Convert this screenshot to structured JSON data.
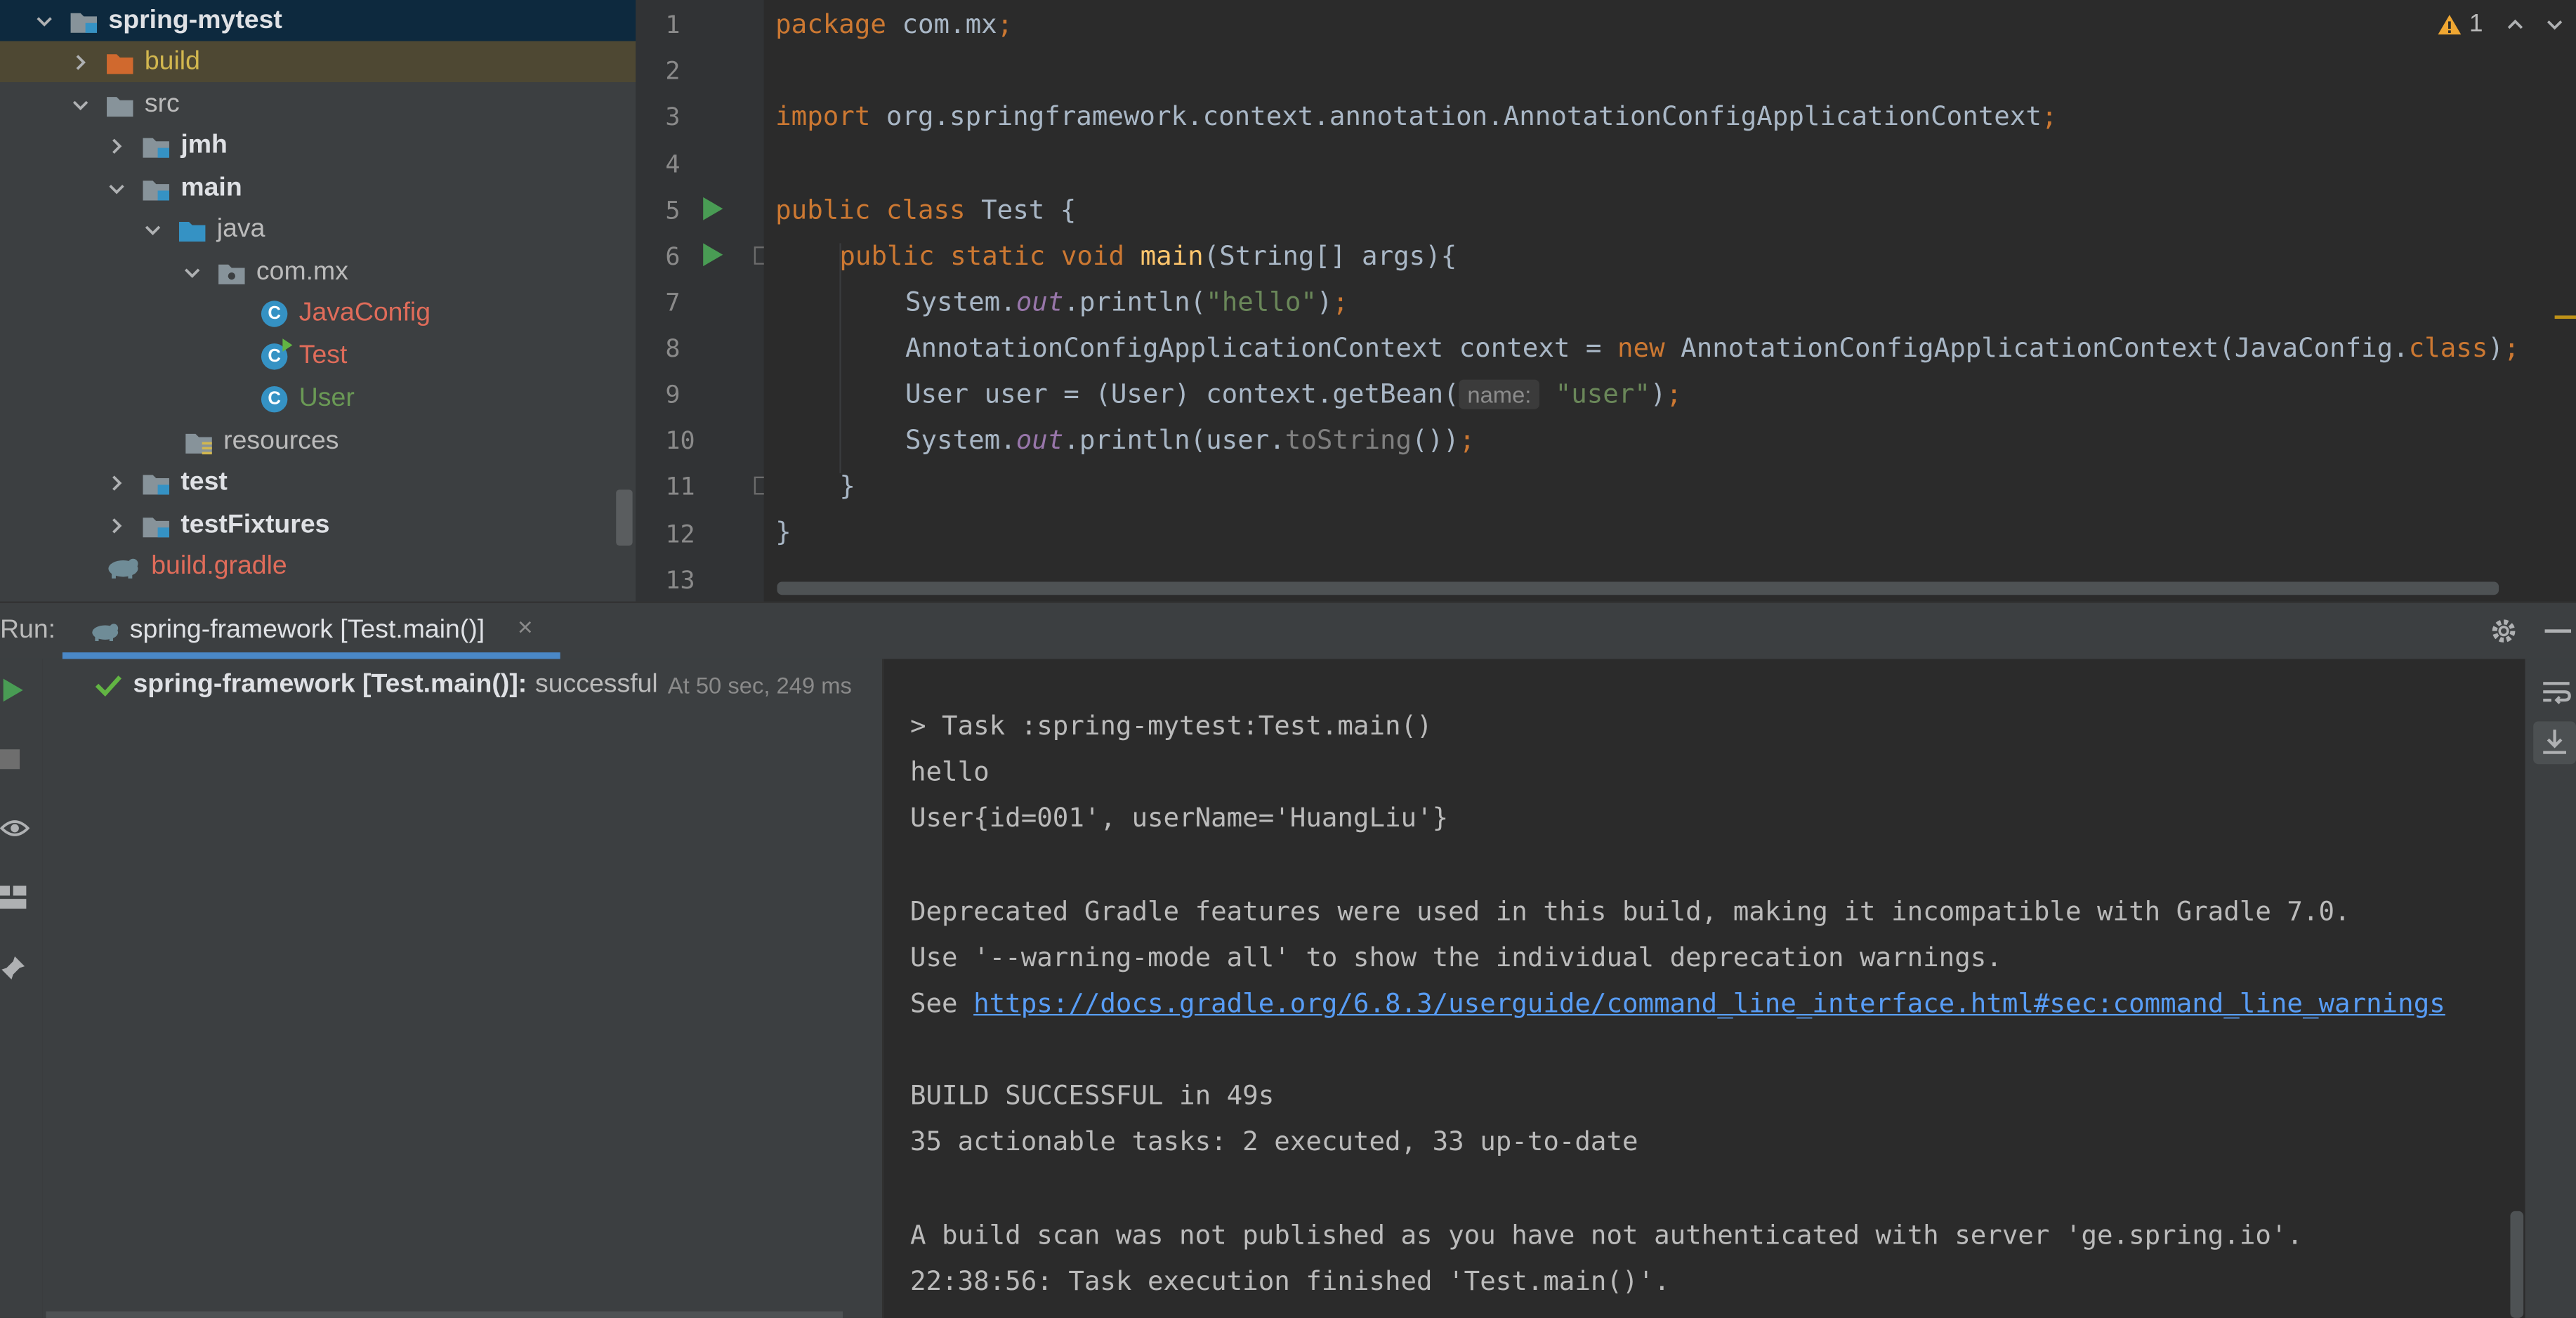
{
  "project_tree": {
    "items": [
      {
        "label": "spring-mytest",
        "level": 0,
        "expanded": true,
        "type": "module",
        "style": "bold"
      },
      {
        "label": "build",
        "level": 1,
        "expanded": false,
        "type": "folder-excluded",
        "style": "yellow"
      },
      {
        "label": "src",
        "level": 1,
        "expanded": true,
        "type": "folder"
      },
      {
        "label": "jmh",
        "level": 2,
        "expanded": false,
        "type": "folder",
        "style": "bold"
      },
      {
        "label": "main",
        "level": 2,
        "expanded": true,
        "type": "folder",
        "style": "bold"
      },
      {
        "label": "java",
        "level": 3,
        "expanded": true,
        "type": "source-folder"
      },
      {
        "label": "com.mx",
        "level": 4,
        "expanded": true,
        "type": "package"
      },
      {
        "label": "JavaConfig",
        "level": 5,
        "type": "class",
        "style": "red"
      },
      {
        "label": "Test",
        "level": 5,
        "type": "class-runnable",
        "style": "red"
      },
      {
        "label": "User",
        "level": 5,
        "type": "class",
        "style": "green"
      },
      {
        "label": "resources",
        "level": 3,
        "type": "resources-folder"
      },
      {
        "label": "test",
        "level": 2,
        "expanded": false,
        "type": "folder",
        "style": "bold"
      },
      {
        "label": "testFixtures",
        "level": 2,
        "expanded": false,
        "type": "folder",
        "style": "bold"
      },
      {
        "label": "build.gradle",
        "level": 1,
        "type": "gradle-file",
        "style": "red"
      }
    ]
  },
  "editor": {
    "line_numbers": [
      "1",
      "2",
      "3",
      "4",
      "5",
      "6",
      "7",
      "8",
      "9",
      "10",
      "11",
      "12",
      "13"
    ],
    "warning_count": "1",
    "lines": {
      "l1": {
        "kw": "package",
        "rest": " com.mx",
        "semi": ";"
      },
      "l3": {
        "kw": "import",
        "rest": " org.springframework.context.annotation.AnnotationConfigApplicationContext",
        "semi": ";"
      },
      "l5": {
        "kw1": "public",
        "kw2": "class",
        "rest": " Test {"
      },
      "l6": {
        "kw1": "public",
        "kw2": "static",
        "kw3": "void",
        "fn": "main",
        "rest": "(String[] args){"
      },
      "l7": {
        "a": "System.",
        "b": "out",
        "c": ".println(",
        "s": "\"hello\"",
        "d": ")",
        "semi": ";"
      },
      "l8": {
        "a": "AnnotationConfigApplicationContext context = ",
        "kw": "new",
        "b": " AnnotationConfigApplicationContext(JavaConfig.",
        "kw2": "class",
        "c": ")",
        "semi": ";"
      },
      "l9": {
        "a": "User user = (User) context.getBean(",
        "hint": "name:",
        "s": "\"user\"",
        "b": ")",
        "semi": ";"
      },
      "l10": {
        "a": "System.",
        "b": "out",
        "c": ".println(user.",
        "m": "toString",
        "d": "())",
        "semi": ";"
      },
      "l11": "}",
      "l12": "}"
    }
  },
  "run_panel": {
    "label": "Run:",
    "tab_label": "spring-framework [Test.main()]",
    "close_glyph": "×",
    "result": {
      "name": "spring-framework [Test.main()]:",
      "status": "successful",
      "time": "At 50 sec, 249 ms"
    },
    "console": {
      "l1": "> Task :spring-mytest:Test.main()",
      "l2": "hello",
      "l3": "User{id=001', userName='HuangLiu'}",
      "l5": "Deprecated Gradle features were used in this build, making it incompatible with Gradle 7.0.",
      "l6": "Use '--warning-mode all' to show the individual deprecation warnings.",
      "l7_prefix": "See ",
      "l7_link": "https://docs.gradle.org/6.8.3/userguide/command_line_interface.html#sec:command_line_warnings",
      "l9": "BUILD SUCCESSFUL in 49s",
      "l10": "35 actionable tasks: 2 executed, 33 up-to-date",
      "l12": "A build scan was not published as you have not authenticated with server 'ge.spring.io'.",
      "l13": "22:38:56: Task execution finished 'Test.main()'."
    }
  },
  "colors": {
    "keyword": "#cc7832",
    "string": "#6a8759",
    "function": "#ffc66d",
    "field": "#9876aa",
    "link": "#589df6",
    "success": "#62b543",
    "accent_tab": "#4a88c7"
  }
}
